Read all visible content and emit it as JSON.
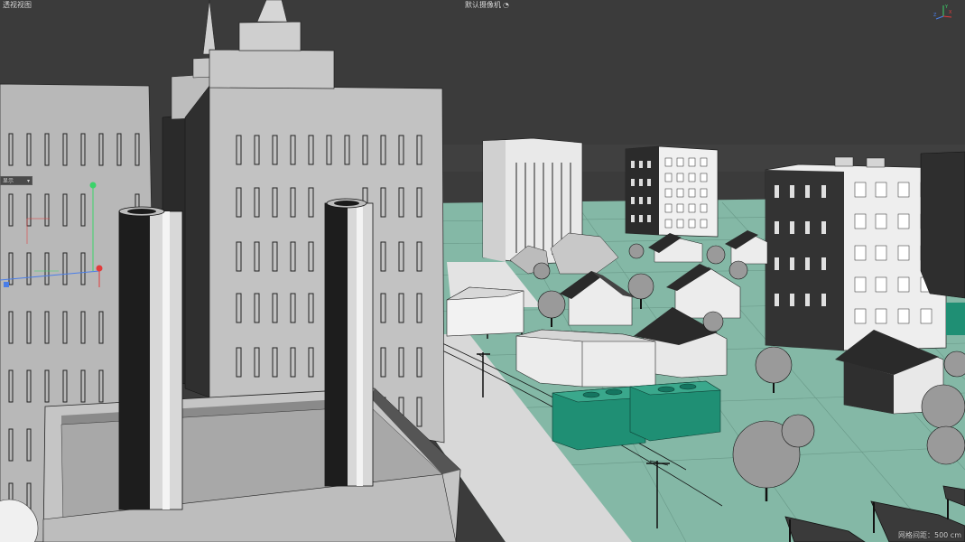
{
  "viewport": {
    "view_name": "透视视图",
    "camera_name": "默认摄像机",
    "camera_icon": "camera-lock-icon",
    "grid_spacing": "网格间距：500 cm",
    "panel_dropdown": "显示"
  },
  "axis_gizmo": {
    "x_color": "#e23b3b",
    "y_color": "#3bd36a",
    "z_color": "#4a7ee8",
    "labels": {
      "y": "Y",
      "z": "Z",
      "x": "X"
    }
  },
  "colors": {
    "background": "#3a3a3a",
    "ground": "#7fb5a2",
    "building": "#c9c9c9",
    "accent_green": "#1f8f74"
  }
}
